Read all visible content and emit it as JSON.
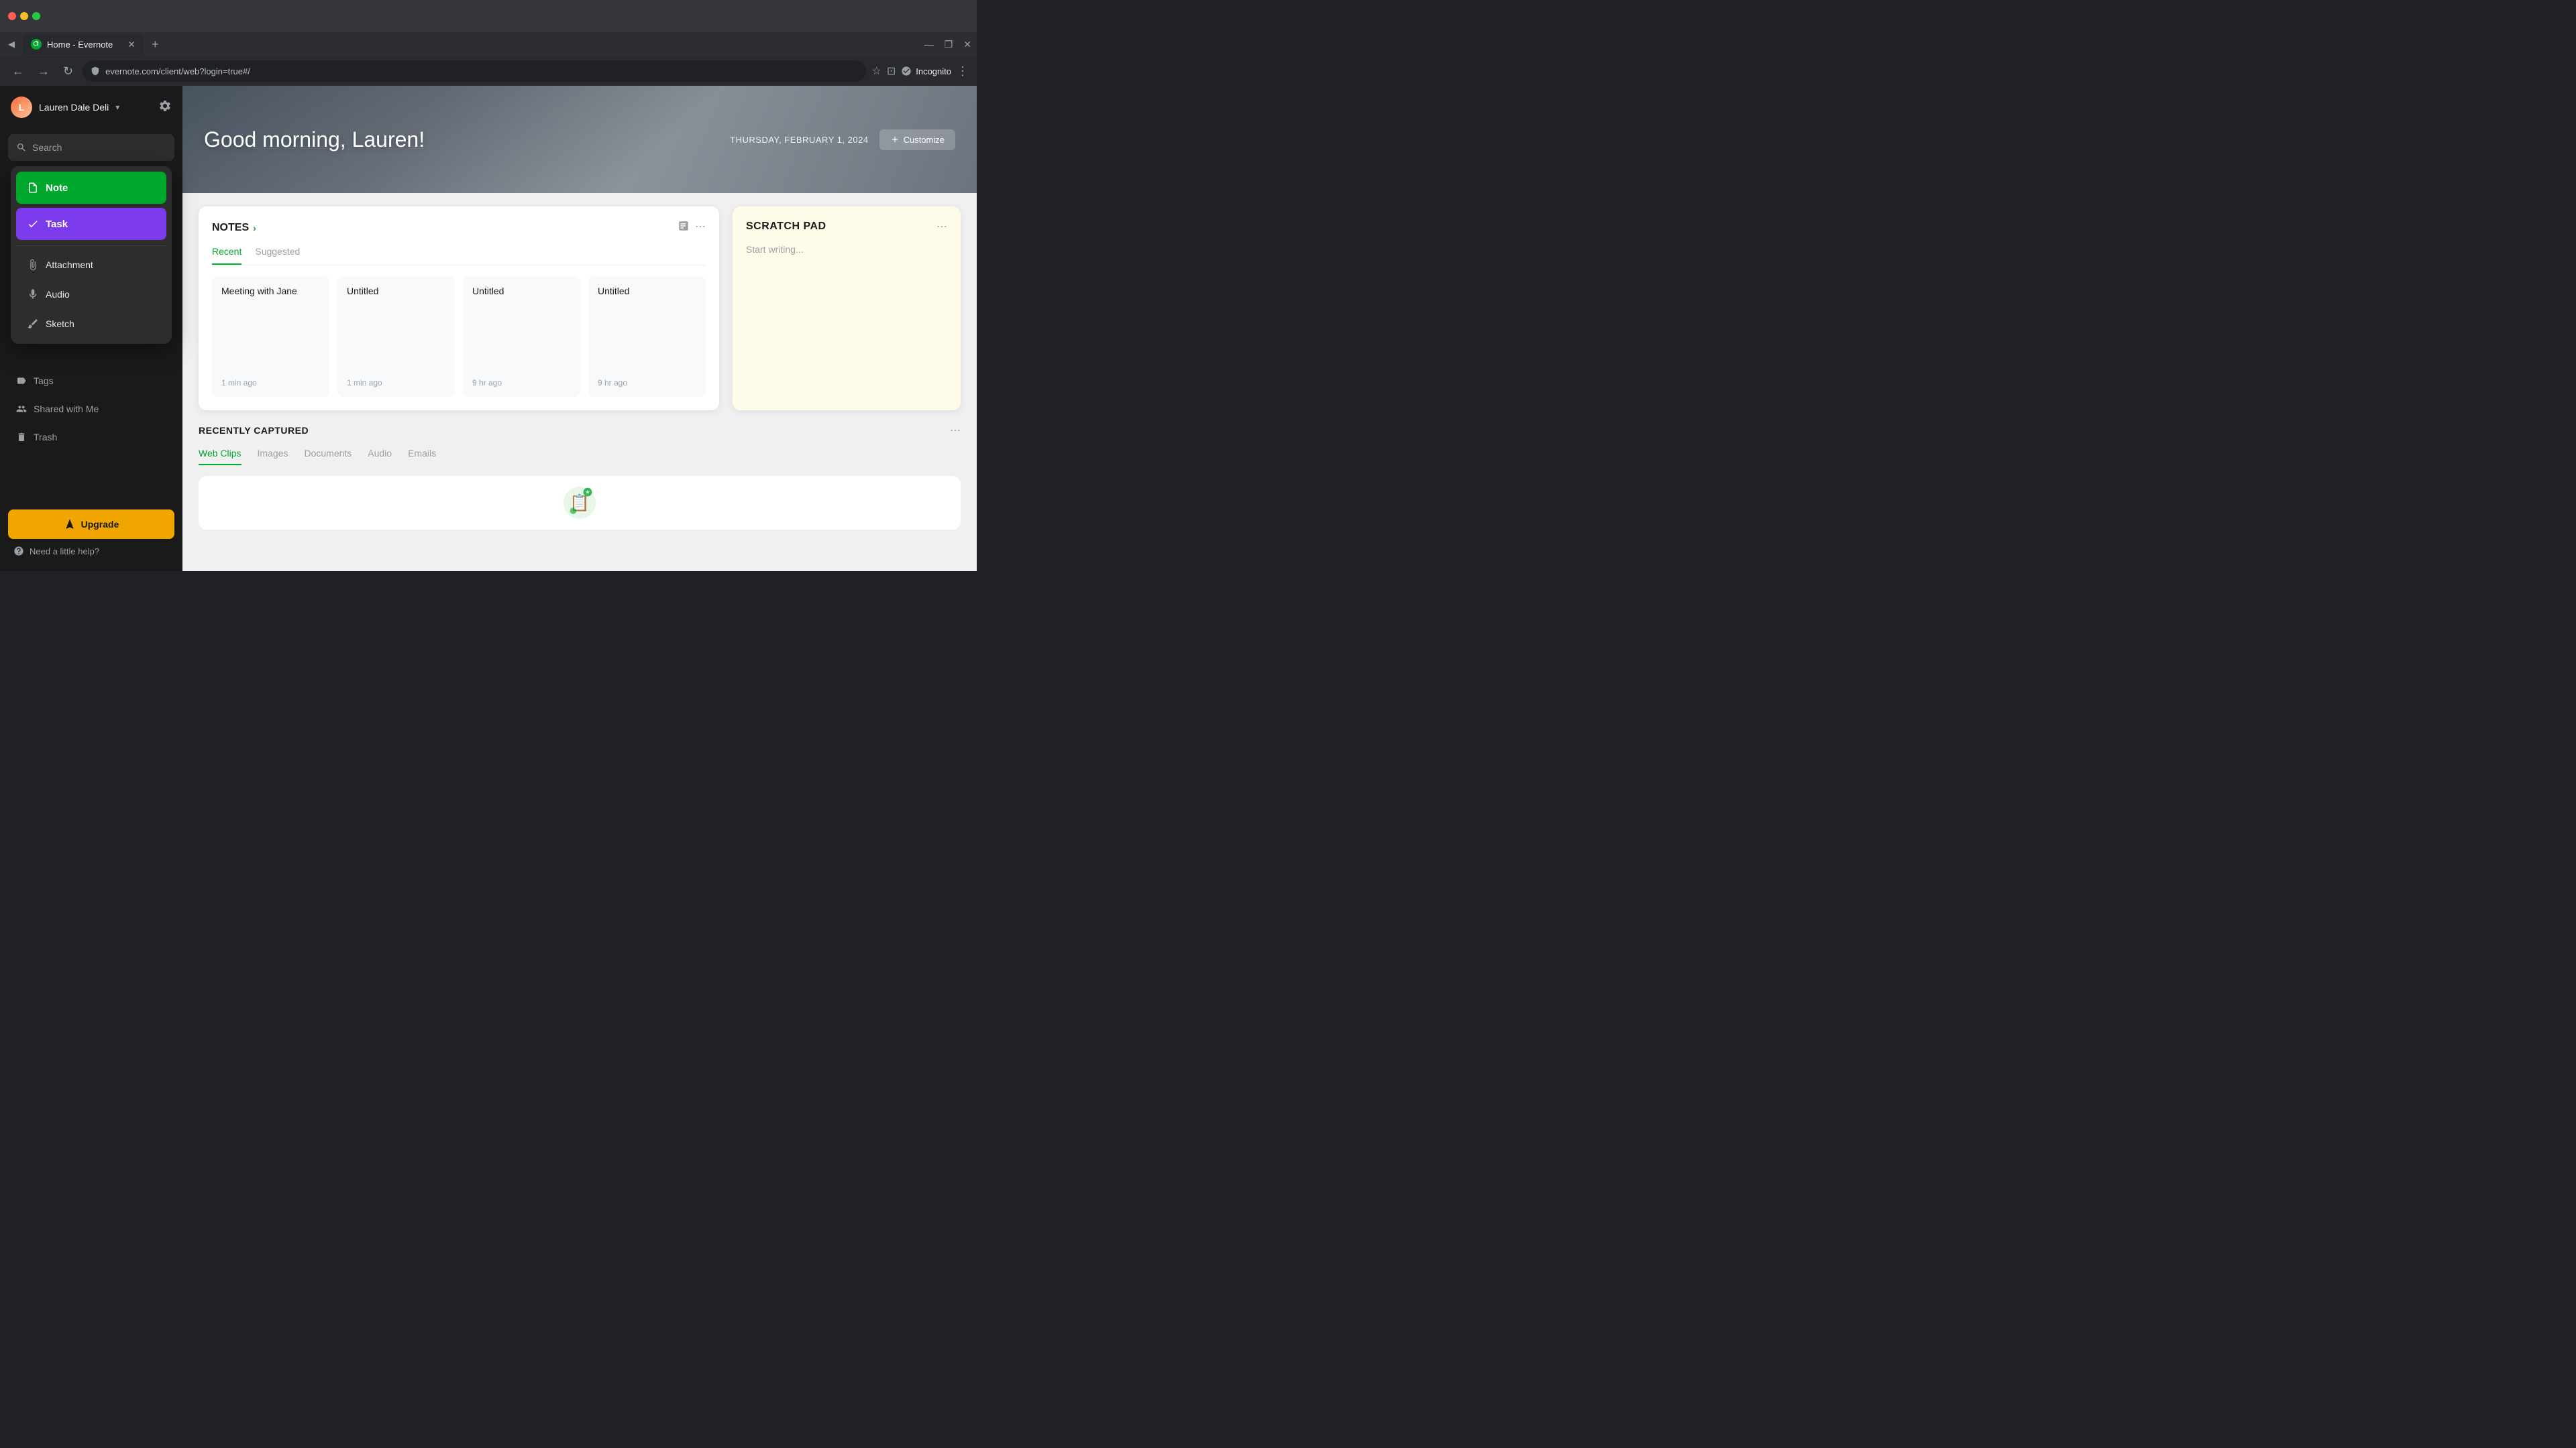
{
  "browser": {
    "tab_title": "Home - Evernote",
    "tab_favicon": "E",
    "url": "evernote.com/client/web?login=true#/",
    "incognito_label": "Incognito"
  },
  "sidebar": {
    "user_name": "Lauren Dale Deli",
    "search_placeholder": "Search",
    "nav_items": [
      {
        "id": "tags",
        "label": "Tags",
        "icon": "🏷"
      },
      {
        "id": "shared",
        "label": "Shared with Me",
        "icon": "👥"
      },
      {
        "id": "trash",
        "label": "Trash",
        "icon": "🗑"
      }
    ],
    "upgrade_label": "Upgrade",
    "help_label": "Need a little help?"
  },
  "dropdown": {
    "note_label": "Note",
    "task_label": "Task",
    "attachment_label": "Attachment",
    "audio_label": "Audio",
    "sketch_label": "Sketch"
  },
  "hero": {
    "greeting": "Good morning, Lauren!",
    "date": "THURSDAY, FEBRUARY 1, 2024",
    "customize_label": "Customize"
  },
  "notes_card": {
    "title": "NOTES",
    "tab_recent": "Recent",
    "tab_suggested": "Suggested",
    "notes": [
      {
        "title": "Meeting with Jane",
        "time": "1 min ago"
      },
      {
        "title": "Untitled",
        "time": "1 min ago"
      },
      {
        "title": "Untitled",
        "time": "9 hr ago"
      },
      {
        "title": "Untitled",
        "time": "9 hr ago"
      }
    ]
  },
  "scratch_pad": {
    "title": "SCRATCH PAD",
    "placeholder": "Start writing..."
  },
  "recently_captured": {
    "title": "RECENTLY CAPTURED",
    "tabs": [
      "Web Clips",
      "Images",
      "Documents",
      "Audio",
      "Emails"
    ],
    "active_tab": "Web Clips"
  }
}
